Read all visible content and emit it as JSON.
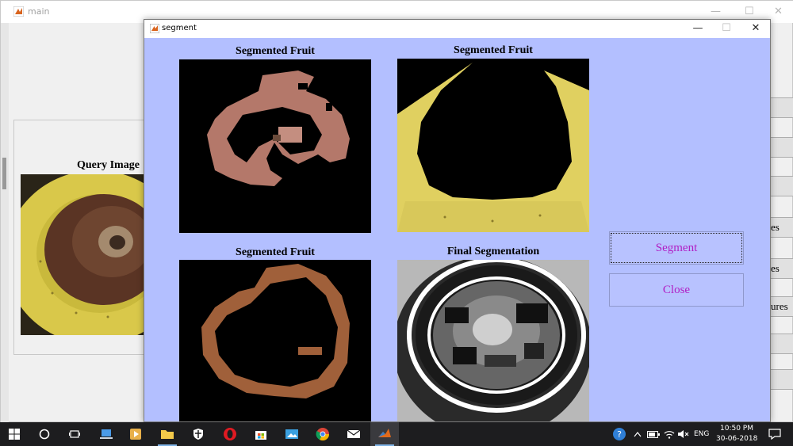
{
  "main_window": {
    "title": "main",
    "query_title": "Query Image",
    "right_button_labels": [
      "",
      "",
      "",
      "es",
      "es",
      "ures",
      "",
      ""
    ]
  },
  "segment_window": {
    "title": "segment",
    "axes": [
      {
        "title": "Segmented Fruit"
      },
      {
        "title": "Segmented Fruit"
      },
      {
        "title": "Segmented Fruit"
      },
      {
        "title": "Final Segmentation"
      }
    ],
    "buttons": {
      "segment": "Segment",
      "close": "Close"
    }
  },
  "taskbar": {
    "pinned_icons": [
      "windows-start-icon",
      "search-circle-icon",
      "task-view-icon",
      "laptop-icon",
      "media-player-icon",
      "file-explorer-icon",
      "security-shield-icon",
      "opera-icon",
      "store-icon",
      "photos-icon",
      "chrome-icon",
      "mail-icon",
      "matlab-icon"
    ],
    "tray": {
      "language": "ENG",
      "time": "10:50 PM",
      "date": "30-06-2018"
    }
  },
  "colors": {
    "figure_background": "#b3bfff",
    "button_text": "#b01fc4",
    "taskbar": "#1d1d1f"
  }
}
